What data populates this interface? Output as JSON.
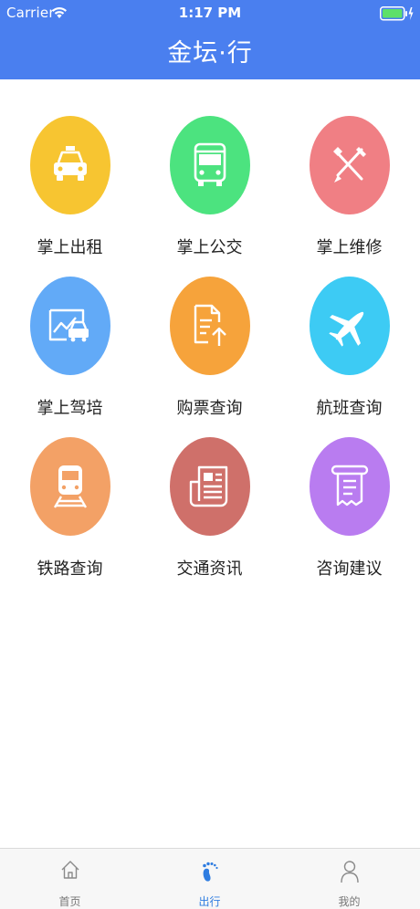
{
  "status_bar": {
    "carrier": "Carrier",
    "time": "1:17 PM"
  },
  "header": {
    "title": "金坛·行"
  },
  "colors": {
    "header_bg": "#4a7fef",
    "tab_active": "#2f7de1",
    "tiles": [
      "#f7c531",
      "#4ce37f",
      "#f07f84",
      "#62aaf7",
      "#f6a33b",
      "#3dcbf4",
      "#f3a166",
      "#cf706a",
      "#b97cf0"
    ]
  },
  "grid": {
    "items": [
      {
        "label": "掌上出租",
        "icon": "taxi-icon"
      },
      {
        "label": "掌上公交",
        "icon": "bus-icon"
      },
      {
        "label": "掌上维修",
        "icon": "wrench-pencil-icon"
      },
      {
        "label": "掌上驾培",
        "icon": "driving-school-icon"
      },
      {
        "label": "购票查询",
        "icon": "ticket-upload-icon"
      },
      {
        "label": "航班查询",
        "icon": "airplane-icon"
      },
      {
        "label": "铁路查询",
        "icon": "train-icon"
      },
      {
        "label": "交通资讯",
        "icon": "news-icon"
      },
      {
        "label": "咨询建议",
        "icon": "scroll-icon"
      }
    ]
  },
  "tabbar": {
    "items": [
      {
        "label": "首页",
        "icon": "home-icon",
        "active": false
      },
      {
        "label": "出行",
        "icon": "footprint-icon",
        "active": true
      },
      {
        "label": "我的",
        "icon": "person-icon",
        "active": false
      }
    ]
  }
}
